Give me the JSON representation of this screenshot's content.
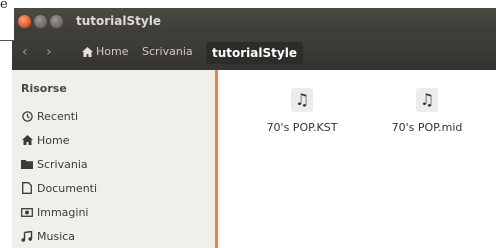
{
  "window": {
    "title": "tutorialStyle"
  },
  "toolbar": {
    "breadcrumbs": [
      "Home",
      "Scrivania",
      "tutorialStyle"
    ]
  },
  "sidebar": {
    "section_title": "Risorse",
    "items": [
      {
        "label": "Recenti",
        "icon": "clock-icon"
      },
      {
        "label": "Home",
        "icon": "home-icon"
      },
      {
        "label": "Scrivania",
        "icon": "desktop-folder-icon"
      },
      {
        "label": "Documenti",
        "icon": "document-icon"
      },
      {
        "label": "Immagini",
        "icon": "camera-icon"
      },
      {
        "label": "Musica",
        "icon": "music-icon"
      }
    ]
  },
  "files": [
    {
      "name": "70's POP.KST",
      "icon": "music-file-icon"
    },
    {
      "name": "70's POP.mid",
      "icon": "music-file-icon"
    }
  ],
  "colors": {
    "accent": "#e8813f",
    "titlebar": "#3c3b37",
    "sidebar": "#f1efec"
  }
}
